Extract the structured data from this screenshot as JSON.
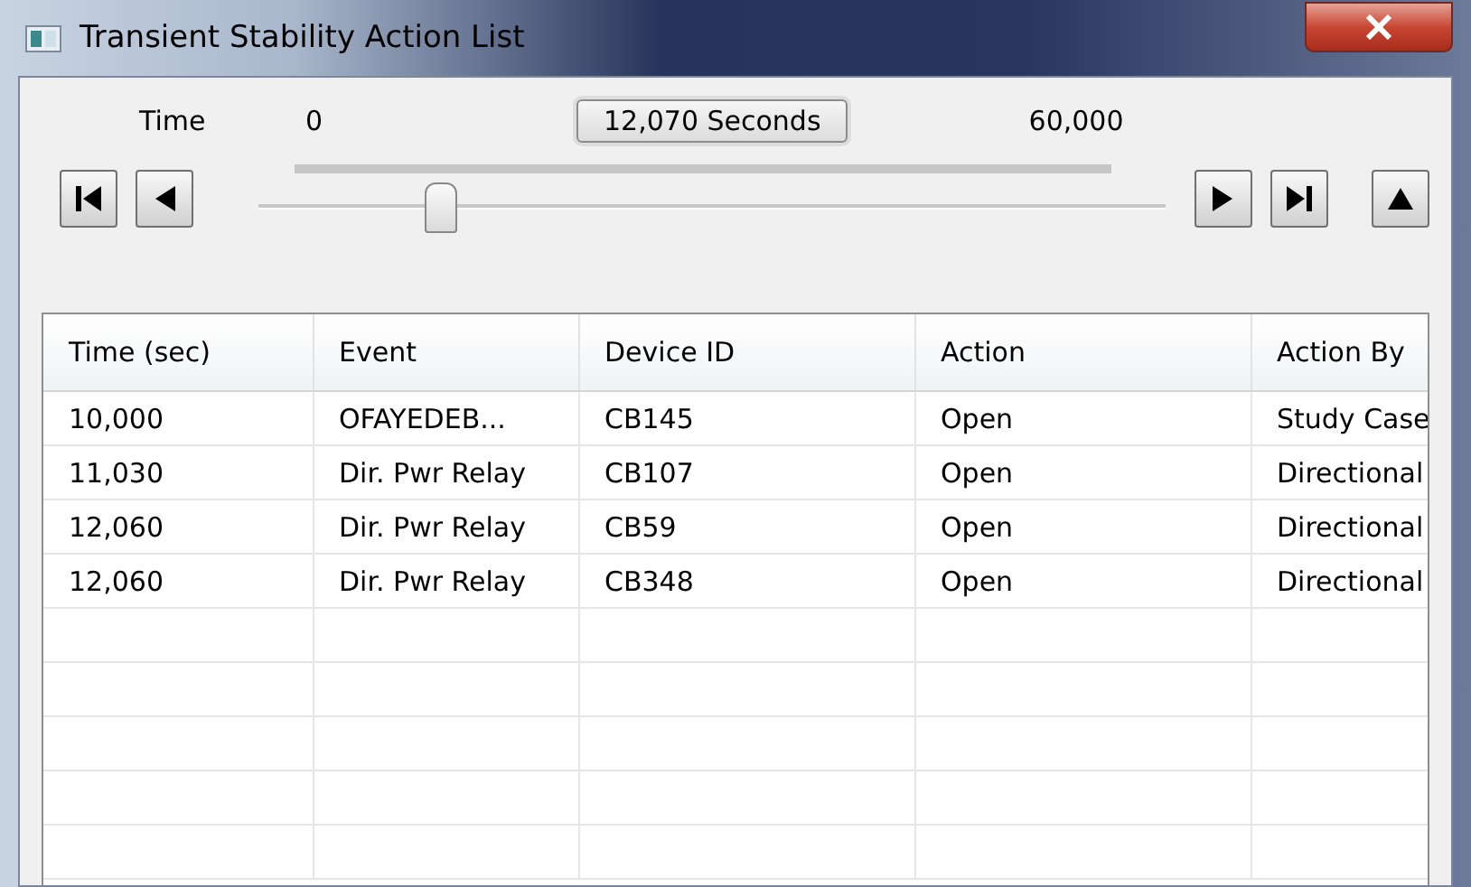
{
  "window": {
    "title": "Transient Stability Action List"
  },
  "time_bar": {
    "label": "Time",
    "min": "0",
    "current": "12,070 Seconds",
    "max": "60,000",
    "level": 0.2
  },
  "table": {
    "columns": [
      "Time (sec)",
      "Event",
      "Device ID",
      "Action",
      "Action By"
    ],
    "rows": [
      [
        "10,000",
        "OFAYEDEB...",
        "CB145",
        "Open",
        "Study Case"
      ],
      [
        "11,030",
        "Dir. Pwr Relay",
        "CB107",
        "Open",
        "Directional"
      ],
      [
        "12,060",
        "Dir. Pwr Relay",
        "CB59",
        "Open",
        "Directional"
      ],
      [
        "12,060",
        "Dir. Pwr Relay",
        "CB348",
        "Open",
        "Directional"
      ]
    ]
  }
}
